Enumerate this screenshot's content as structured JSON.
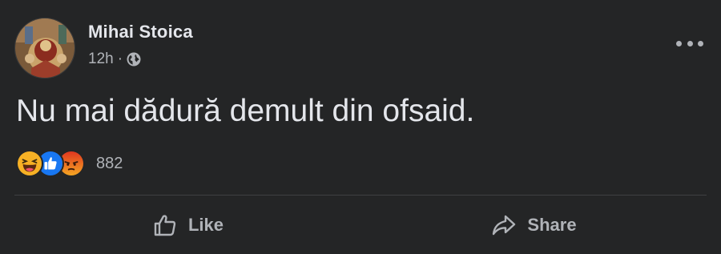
{
  "post": {
    "author": "Mihai Stoica",
    "time": "12h",
    "separator": "·",
    "audience_icon": "globe-icon",
    "more_icon": "more-options-icon",
    "text": "Nu mai dădură demult din ofsaid."
  },
  "reactions": {
    "types": [
      "haha",
      "like",
      "angry"
    ],
    "count": "882"
  },
  "actions": {
    "like_label": "Like",
    "share_label": "Share"
  },
  "colors": {
    "background": "#242526",
    "primary_text": "#e4e6eb",
    "secondary_text": "#b0b3b8",
    "divider": "#3e4042",
    "like_blue": "#1877f2",
    "haha_yellow": "#f7b125",
    "angry_orange": "#e9710f"
  }
}
